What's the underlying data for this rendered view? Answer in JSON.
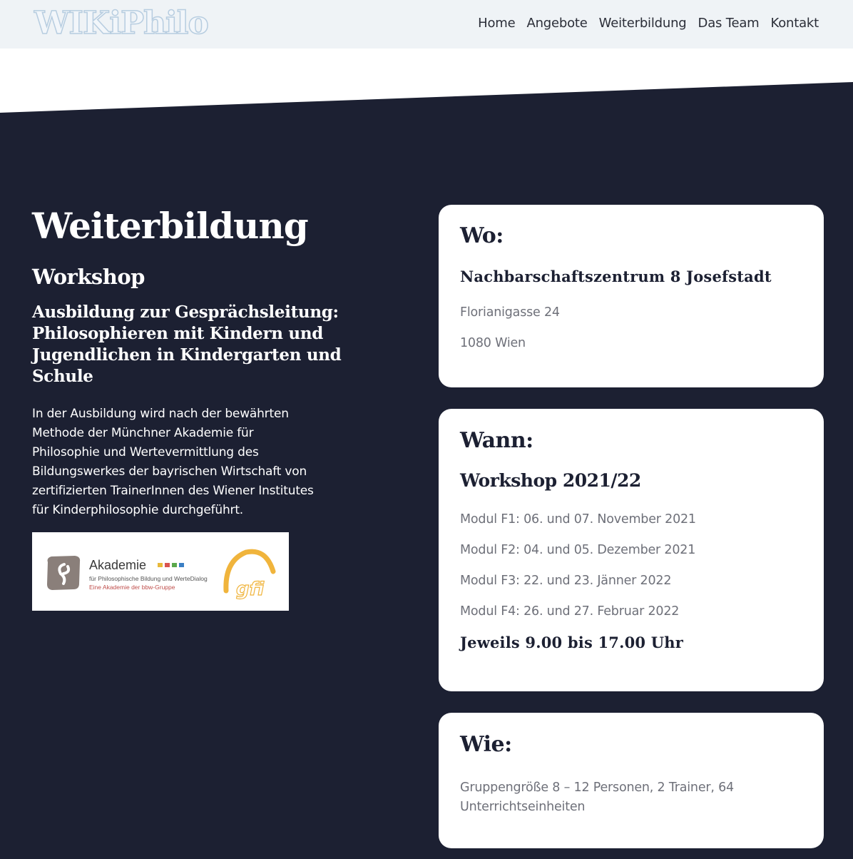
{
  "header": {
    "logo": "WIKiPhilo",
    "nav": [
      "Home",
      "Angebote",
      "Weiterbildung",
      "Das Team",
      "Kontakt"
    ]
  },
  "intro": {
    "title": "Weiterbildung",
    "subtitle": "Workshop",
    "heading_lines": [
      "Ausbildung zur Gesprächsleitung:",
      "Philosophieren mit Kindern und",
      "Jugendlichen in Kindergarten und",
      "Schule"
    ],
    "description_lines": [
      "In der Ausbildung wird nach der bewährten",
      "Methode der Münchner Akademie für",
      "Philosophie und Wertevermittlung des",
      "Bildungswerkes der bayrischen Wirtschaft von",
      "zertifizierten TrainerInnen des Wiener Institutes",
      "für Kinderphilosophie durchgeführt."
    ],
    "partner_logo": {
      "name": "Akademie",
      "line1": "für Philosophische Bildung und WerteDialog",
      "line2": "Eine Akademie der bbw-Gruppe",
      "mark": "gfi",
      "colors": [
        "#e8b93a",
        "#d9534f",
        "#5aa84b",
        "#3b7fc4"
      ]
    }
  },
  "where": {
    "title": "Wo:",
    "place": "Nachbarschaftszentrum 8 Josefstadt",
    "street": "Florianigasse 24",
    "city": "1080 Wien"
  },
  "when": {
    "title": "Wann:",
    "subtitle": "Workshop 2021/22",
    "modules": [
      "Modul F1: 06. und 07. November 2021",
      "Modul F2: 04. und 05. Dezember 2021",
      "Modul F3: 22. und 23. Jänner 2022",
      "Modul F4: 26. und 27. Februar 2022"
    ],
    "time": "Jeweils 9.00 bis 17.00 Uhr"
  },
  "how": {
    "title": "Wie:",
    "lines": [
      "Gruppengröße 8 – 12 Personen, 2 Trainer, 64",
      "Unterrichtseinheiten"
    ]
  },
  "colors": {
    "background": "#1c2032",
    "header": "#eff3f6",
    "card": "#ffffff",
    "muted_text": "#6e7079"
  }
}
